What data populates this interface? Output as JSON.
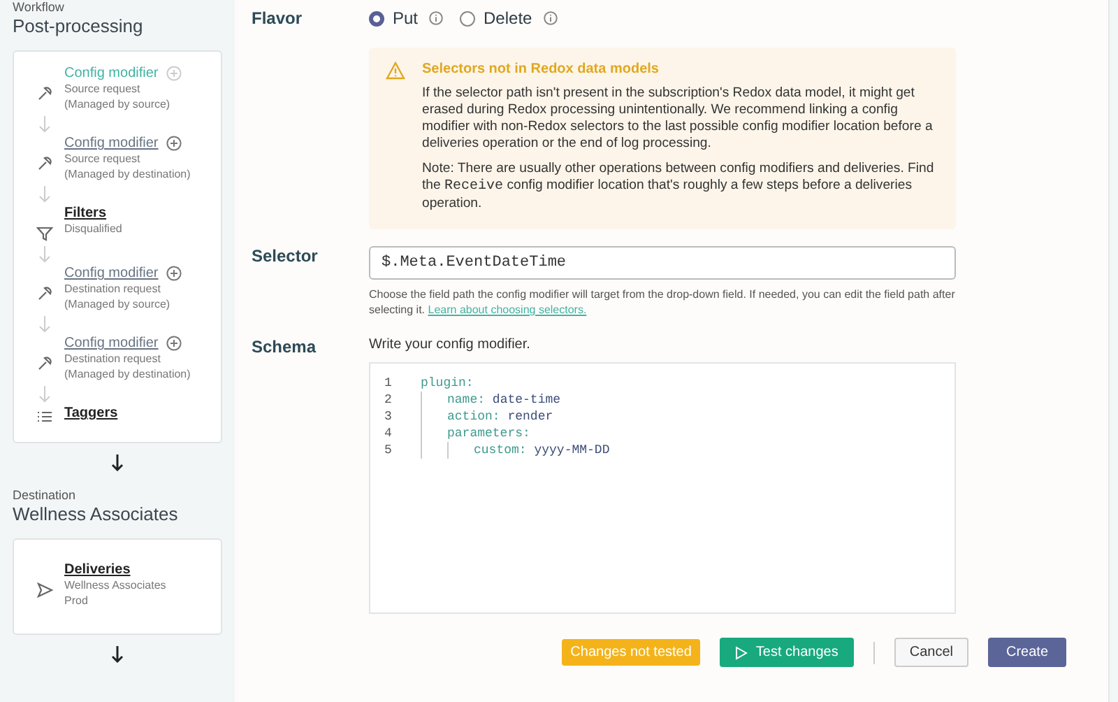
{
  "sidebar": {
    "sections": [
      {
        "caption": "Workflow",
        "title": "Post-processing",
        "items": [
          {
            "kind": "config",
            "label": "Config modifier",
            "selected": true,
            "details": [
              "Source request",
              "(Managed by source)"
            ]
          },
          {
            "kind": "config",
            "label": "Config modifier",
            "selected": false,
            "details": [
              "Source request",
              "(Managed by destination)"
            ]
          },
          {
            "kind": "filter",
            "label": "Filters",
            "selected": false,
            "details": [
              "Disqualified"
            ]
          },
          {
            "kind": "config",
            "label": "Config modifier",
            "selected": false,
            "details": [
              "Destination request",
              "(Managed by source)"
            ]
          },
          {
            "kind": "config",
            "label": "Config modifier",
            "selected": false,
            "details": [
              "Destination request",
              "(Managed by destination)"
            ]
          },
          {
            "kind": "taggers",
            "label": "Taggers",
            "selected": false
          }
        ]
      },
      {
        "caption": "Destination",
        "title": "Wellness Associates",
        "items": [
          {
            "kind": "deliveries",
            "label": "Deliveries",
            "selected": false,
            "details": [
              "Wellness Associates",
              "Prod"
            ]
          }
        ]
      }
    ]
  },
  "form": {
    "flavor": {
      "label": "Flavor",
      "options": [
        {
          "label": "Put",
          "selected": true
        },
        {
          "label": "Delete",
          "selected": false
        }
      ]
    },
    "warning": {
      "title": "Selectors not in Redox data models",
      "body": "If the selector path isn't present in the subscription's Redox data model, it might get erased during Redox processing unintentionally. We recommend linking a config modifier with non-Redox selectors to the last possible config modifier location before a deliveries operation or the end of log processing.",
      "note": {
        "before": "Note: There are usually other operations between config modifiers and deliveries. Find the",
        "code": "Receive",
        "after": "config modifier location that's roughly a few steps before a deliveries operation."
      }
    },
    "selector": {
      "label": "Selector",
      "value": "$.Meta.EventDateTime",
      "help": "Choose the field path the config modifier will target from the drop-down field. If needed, you can edit the field path after selecting it.",
      "link": "Learn about choosing selectors."
    },
    "schema": {
      "label": "Schema",
      "hint": "Write your config modifier.",
      "code": [
        {
          "number": "1",
          "key": "plugin:",
          "children": [
            {
              "number": "2",
              "key": "name:",
              "value": "date-time"
            },
            {
              "number": "3",
              "key": "action:",
              "value": "render"
            },
            {
              "number": "4",
              "key": "parameters:",
              "children": [
                {
                  "number": "5",
                  "key": "custom:",
                  "value": "yyyy-MM-DD"
                }
              ]
            }
          ]
        }
      ]
    }
  },
  "footer": {
    "status": "Changes not tested",
    "buttons": [
      {
        "kind": "test",
        "label": "Test changes"
      },
      {
        "kind": "cancel",
        "label": "Cancel"
      },
      {
        "kind": "primary",
        "label": "Create"
      }
    ]
  }
}
